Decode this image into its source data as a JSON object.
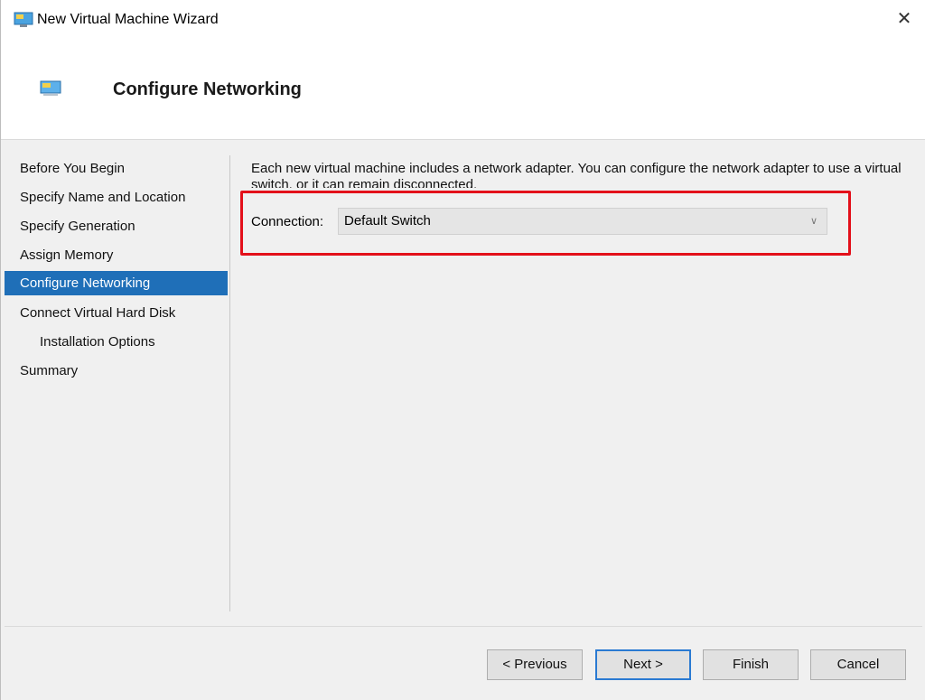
{
  "window": {
    "title": "New Virtual Machine Wizard",
    "close_glyph": "✕"
  },
  "header": {
    "title": "Configure Networking",
    "icon": "monitor-icon"
  },
  "nav": {
    "items": [
      {
        "label": "Before You Begin"
      },
      {
        "label": "Specify Name and Location"
      },
      {
        "label": "Specify Generation"
      },
      {
        "label": "Assign Memory"
      },
      {
        "label": "Configure Networking"
      },
      {
        "label": "Connect Virtual Hard Disk"
      },
      {
        "label": "Installation Options"
      },
      {
        "label": "Summary"
      }
    ],
    "active_index": 4
  },
  "content": {
    "description": "Each new virtual machine includes a network adapter. You can configure the network adapter to use a virtual switch, or it can remain disconnected.",
    "connection_label": "Connection:",
    "connection_value": "Default Switch"
  },
  "buttons": {
    "previous": "< Previous",
    "next": "Next >",
    "finish": "Finish",
    "cancel": "Cancel"
  },
  "colors": {
    "active_nav": "#1f6fb8",
    "highlight_box": "#e3101a",
    "default_button_border": "#2a7ad2"
  }
}
